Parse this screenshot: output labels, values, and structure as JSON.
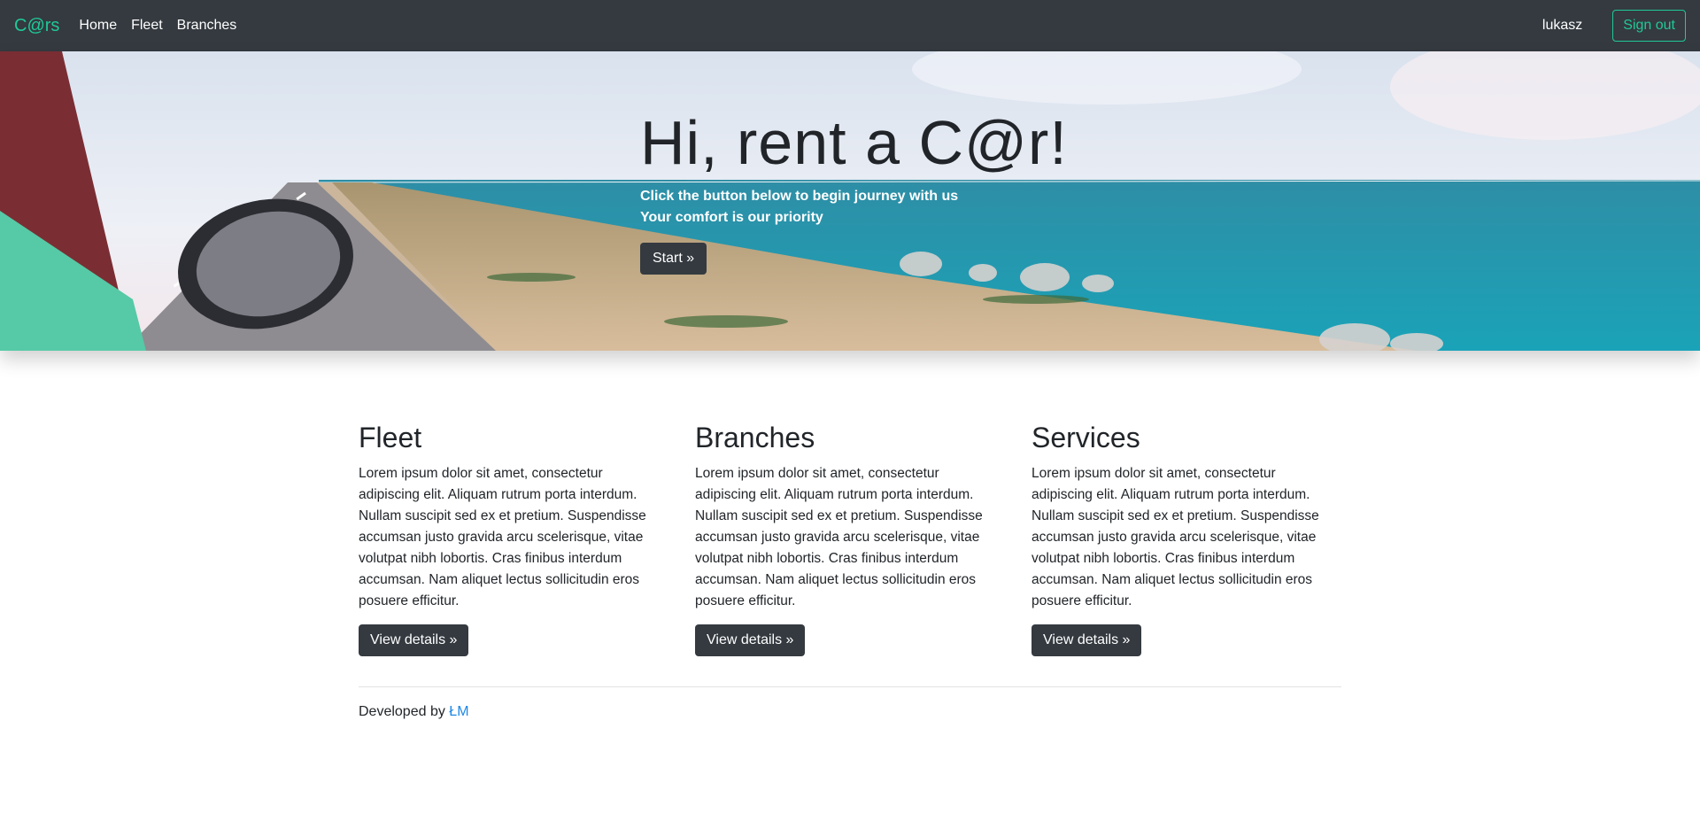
{
  "navbar": {
    "brand": "C@rs",
    "links": [
      "Home",
      "Fleet",
      "Branches"
    ],
    "username": "lukasz",
    "signout_label": "Sign out"
  },
  "hero": {
    "title": "Hi, rent a C@r!",
    "subtitle_line1": "Click the button below to begin journey with us",
    "subtitle_line2": "Your comfort is our priority",
    "start_label": "Start »"
  },
  "columns": [
    {
      "title": "Fleet",
      "text": "Lorem ipsum dolor sit amet, consectetur adipiscing elit. Aliquam rutrum porta interdum. Nullam suscipit sed ex et pretium. Suspendisse accumsan justo gravida arcu scelerisque, vitae volutpat nibh lobortis. Cras finibus interdum accumsan. Nam aliquet lectus sollicitudin eros posuere efficitur.",
      "button": "View details »"
    },
    {
      "title": "Branches",
      "text": "Lorem ipsum dolor sit amet, consectetur adipiscing elit. Aliquam rutrum porta interdum. Nullam suscipit sed ex et pretium. Suspendisse accumsan justo gravida arcu scelerisque, vitae volutpat nibh lobortis. Cras finibus interdum accumsan. Nam aliquet lectus sollicitudin eros posuere efficitur.",
      "button": "View details »"
    },
    {
      "title": "Services",
      "text": "Lorem ipsum dolor sit amet, consectetur adipiscing elit. Aliquam rutrum porta interdum. Nullam suscipit sed ex et pretium. Suspendisse accumsan justo gravida arcu scelerisque, vitae volutpat nibh lobortis. Cras finibus interdum accumsan. Nam aliquet lectus sollicitudin eros posuere efficitur.",
      "button": "View details »"
    }
  ],
  "footer": {
    "prefix": "Developed by ",
    "author": "ŁM"
  },
  "colors": {
    "navbar_bg": "#343a40",
    "accent": "#20c997",
    "link": "#1e88e5"
  }
}
